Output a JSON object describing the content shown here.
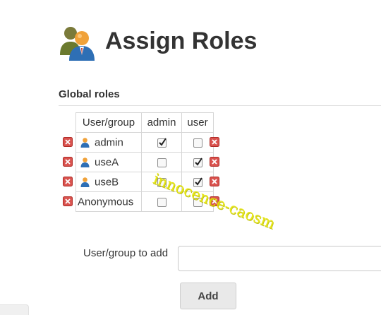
{
  "header": {
    "title": "Assign Roles",
    "icon": "assign-roles-users-icon"
  },
  "global_roles": {
    "section_title": "Global roles",
    "columns": [
      "User/group",
      "admin",
      "user"
    ],
    "rows": [
      {
        "name": "admin",
        "icon": "user-icon",
        "admin": true,
        "user": false
      },
      {
        "name": "useA",
        "icon": "user-icon",
        "admin": false,
        "user": true
      },
      {
        "name": "useB",
        "icon": "user-icon",
        "admin": false,
        "user": true
      },
      {
        "name": "Anonymous",
        "icon": null,
        "admin": false,
        "user": false
      }
    ],
    "delete_icon": "red-x-delete-icon"
  },
  "add_form": {
    "label": "User/group to add",
    "value": "",
    "placeholder": "",
    "button_label": "Add"
  },
  "watermark": {
    "text": "innocence-caosm"
  },
  "colors": {
    "delete_red": "#d9534f",
    "watermark_yellow": "#e6e600",
    "button_gray": "#e9e9e9",
    "text": "#333333"
  }
}
